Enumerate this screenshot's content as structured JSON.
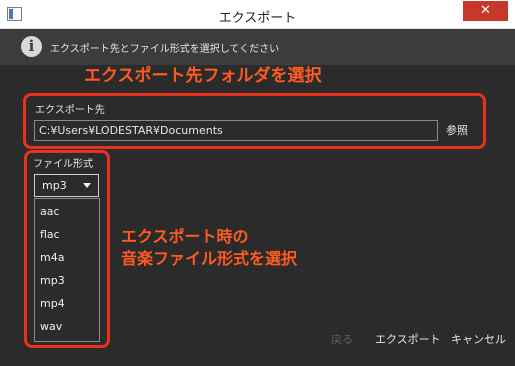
{
  "window": {
    "title": "エクスポート",
    "close_glyph": "✕"
  },
  "info": {
    "icon_glyph": "i",
    "message": "エクスポート先とファイル形式を選択してください"
  },
  "annotations": {
    "destination": "エクスポート先フォルダを選択",
    "format_line1": "エクスポート時の",
    "format_line2": "音楽ファイル形式を選択"
  },
  "destination": {
    "label": "エクスポート先",
    "path": "C:¥Users¥LODESTAR¥Documents",
    "browse_label": "参照"
  },
  "format": {
    "label": "ファイル形式",
    "selected": "mp3",
    "options": [
      "aac",
      "flac",
      "m4a",
      "mp3",
      "mp4",
      "wav"
    ]
  },
  "footer": {
    "back_label": "戻る",
    "export_label": "エクスポート",
    "cancel_label": "キャンセル"
  },
  "colors": {
    "annotation": "#ff5a1f",
    "annotation_box": "#e8321c",
    "close_button": "#c7382c",
    "background": "#2b2b2b"
  }
}
